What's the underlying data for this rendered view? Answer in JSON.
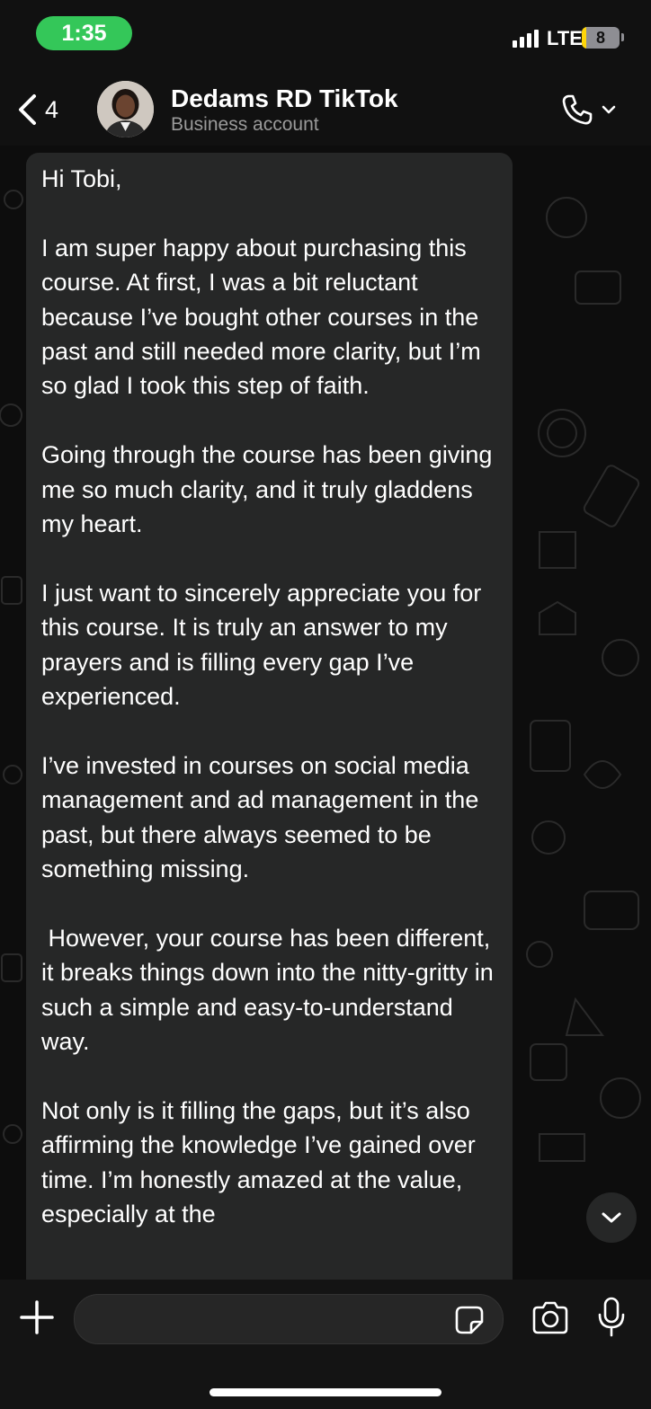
{
  "status_bar": {
    "time": "1:35",
    "network": "LTE",
    "battery": "8",
    "colors": {
      "time_pill": "#34c759",
      "battery_low": "#ffd60a"
    }
  },
  "header": {
    "back_count": "4",
    "contact_name": "Dedams RD TikTok",
    "contact_subtitle": "Business account",
    "icons": [
      "chevron-left-icon",
      "avatar",
      "phone-icon",
      "chevron-down-icon"
    ]
  },
  "message": {
    "paragraphs": [
      "Hi Tobi,",
      "I am super happy about purchasing this course. At first, I was a bit reluctant because I’ve bought other courses in the past and still needed more clarity, but I’m so glad I took this step of faith.",
      "Going through the course has been giving me so much clarity, and it truly gladdens my heart.",
      "I just want to sincerely appreciate you for this course. It is truly an answer to my prayers and is filling every gap I’ve experienced.",
      "I’ve invested in courses on social media management and ad management in the past, but there always seemed to be something missing.",
      " However, your course has been different, it breaks things down into the nitty-gritty in such a simple and easy-to-understand way.",
      "Not only is it filling the gaps, but it’s also affirming the knowledge I’ve gained over time. I’m honestly amazed at the value, especially at the"
    ]
  },
  "composer": {
    "input_value": "",
    "icons": [
      "plus-icon",
      "sticker-icon",
      "camera-icon",
      "microphone-icon"
    ]
  },
  "colors": {
    "bubble": "#262727",
    "header_bg": "#111111",
    "subtitle_text": "#9a9a9a"
  }
}
